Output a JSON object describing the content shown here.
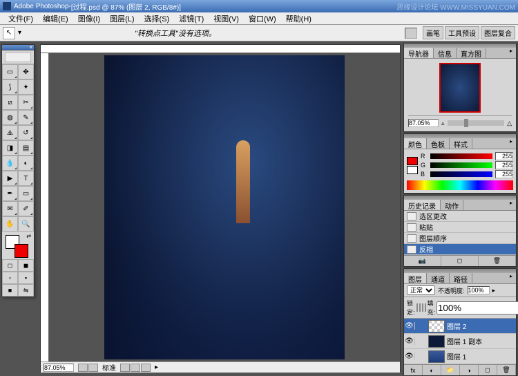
{
  "watermark": {
    "brand": "思缘设计论坛",
    "url": "WWW.MISSYUAN.COM"
  },
  "titlebar": {
    "app": "Adobe Photoshop",
    "doc": "[过程.psd @ 87% (图层 2, RGB/8#)]"
  },
  "menu": {
    "file": "文件(F)",
    "edit": "编辑(E)",
    "image": "图像(I)",
    "layer": "图层(L)",
    "select": "选择(S)",
    "filter": "滤镜(T)",
    "view": "视图(V)",
    "window": "窗口(W)",
    "help": "帮助(H)"
  },
  "options": {
    "message": "\"转换点工具\"没有选项。",
    "palette_tabs": {
      "brushes": "画笔",
      "tool_presets": "工具预设",
      "layer_comps": "图层复合"
    }
  },
  "navigator": {
    "tabs": {
      "navigator": "导航器",
      "info": "信息",
      "histogram": "直方图"
    },
    "zoom": "87.05%"
  },
  "color_panel": {
    "tabs": {
      "color": "颜色",
      "swatches": "色板",
      "styles": "样式"
    },
    "r_label": "R",
    "g_label": "G",
    "b_label": "B",
    "r": "255",
    "g": "255",
    "b": "255"
  },
  "history_panel": {
    "tabs": {
      "history": "历史记录",
      "actions": "动作"
    },
    "items": [
      "选区更改",
      "粘贴",
      "图层顺序",
      "反相"
    ]
  },
  "layers_panel": {
    "tabs": {
      "layers": "图层",
      "channels": "通道",
      "paths": "路径"
    },
    "blend_mode": "正常",
    "opacity_label": "不透明度:",
    "opacity_val": "100%",
    "lock_label": "锁定:",
    "fill_label": "填充:",
    "fill_val": "100%",
    "layers": [
      {
        "name": "图层 2",
        "thumb": "checker",
        "selected": true
      },
      {
        "name": "图层 1 副本",
        "thumb": "dark",
        "selected": false
      },
      {
        "name": "图层 1",
        "thumb": "img",
        "selected": false
      }
    ]
  },
  "status": {
    "zoom": "87.05%",
    "label": "标准"
  }
}
